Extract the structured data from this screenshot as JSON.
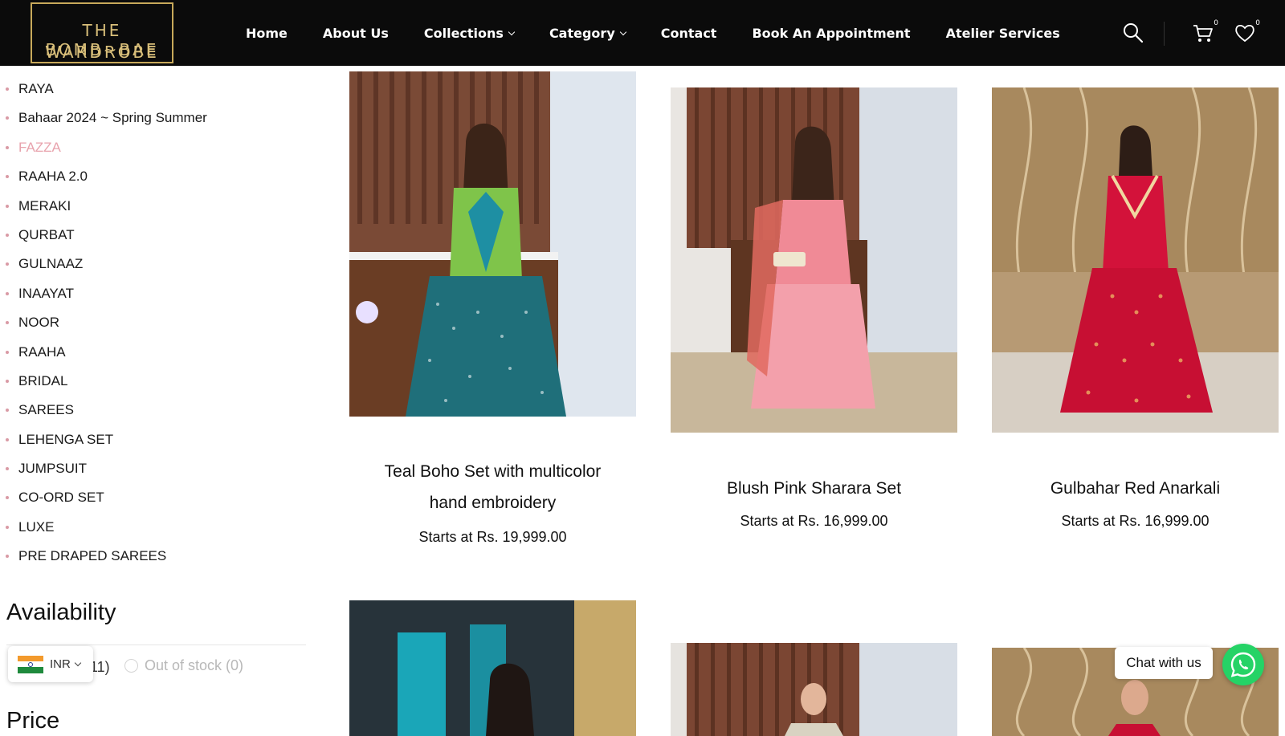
{
  "brand": {
    "logo_line1": "THE BOMB~BAE",
    "logo_line2": "WARDROBE",
    "gold": "#c8a95a"
  },
  "nav": {
    "items": [
      {
        "label": "Home"
      },
      {
        "label": "About Us"
      },
      {
        "label": "Collections",
        "has_dropdown": true
      },
      {
        "label": "Category",
        "has_dropdown": true
      },
      {
        "label": "Contact"
      },
      {
        "label": "Book An Appointment"
      },
      {
        "label": "Atelier Services"
      }
    ]
  },
  "header_icons": {
    "search": "search-icon",
    "cart": "cart-icon",
    "cart_count": "0",
    "wishlist": "heart-icon",
    "wishlist_count": "0"
  },
  "sidebar": {
    "categories": [
      {
        "label": "RAYA"
      },
      {
        "label": "Bahaar 2024 ~ Spring Summer"
      },
      {
        "label": "FAZZA",
        "active": true
      },
      {
        "label": "RAAHA 2.0"
      },
      {
        "label": "MERAKI"
      },
      {
        "label": "QURBAT"
      },
      {
        "label": "GULNAAZ"
      },
      {
        "label": "INAAYAT"
      },
      {
        "label": "NOOR"
      },
      {
        "label": "RAAHA"
      },
      {
        "label": "BRIDAL"
      },
      {
        "label": "SAREES"
      },
      {
        "label": "LEHENGA SET"
      },
      {
        "label": "JUMPSUIT"
      },
      {
        "label": "CO-ORD SET"
      },
      {
        "label": "LUXE"
      },
      {
        "label": "PRE DRAPED SAREES"
      }
    ],
    "availability": {
      "title": "Availability",
      "in_stock_visible_tail": "11)",
      "out_of_stock_label": "Out of stock (0)"
    },
    "price_title": "Price",
    "active_color": "#e8a3ad"
  },
  "currency": {
    "code": "INR",
    "flag": "india-flag-icon"
  },
  "products": [
    {
      "title_line1": "Teal Boho Set with multicolor",
      "title_line2": "hand embroidery",
      "price": "Starts at Rs. 19,999.00"
    },
    {
      "title_line1": "Blush Pink Sharara Set",
      "price": "Starts at Rs. 16,999.00"
    },
    {
      "title_line1": "Gulbahar Red Anarkali",
      "price": "Starts at Rs. 16,999.00"
    }
  ],
  "chat": {
    "label": "Chat with us",
    "icon": "whatsapp-icon",
    "color": "#25d366"
  }
}
